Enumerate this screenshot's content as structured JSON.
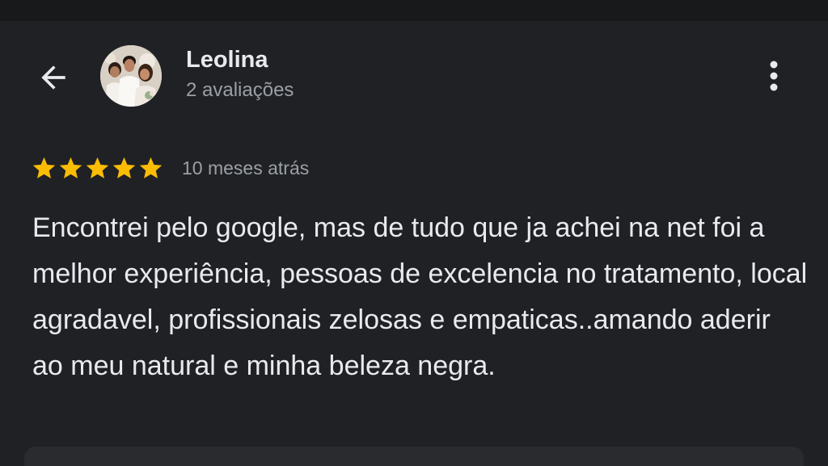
{
  "header": {
    "reviewer_name": "Leolina",
    "review_count": "2 avaliações",
    "icons": {
      "back": "arrow-back-icon",
      "more": "more-vert-icon",
      "avatar": "reviewer-avatar-photo"
    }
  },
  "review": {
    "rating": 5,
    "rating_max": 5,
    "star_color": "#fbbc04",
    "date": "10 meses atrás",
    "text": "Encontrei pelo google, mas de tudo que ja achei na net foi a melhor experiência, pessoas de excelencia no tratamento, local agradavel, profissionais zelosas e empaticas..amando aderir ao meu natural e minha beleza negra."
  },
  "colors": {
    "background": "#202124",
    "primary_text": "#e8eaed",
    "secondary_text": "#9aa0a6"
  }
}
